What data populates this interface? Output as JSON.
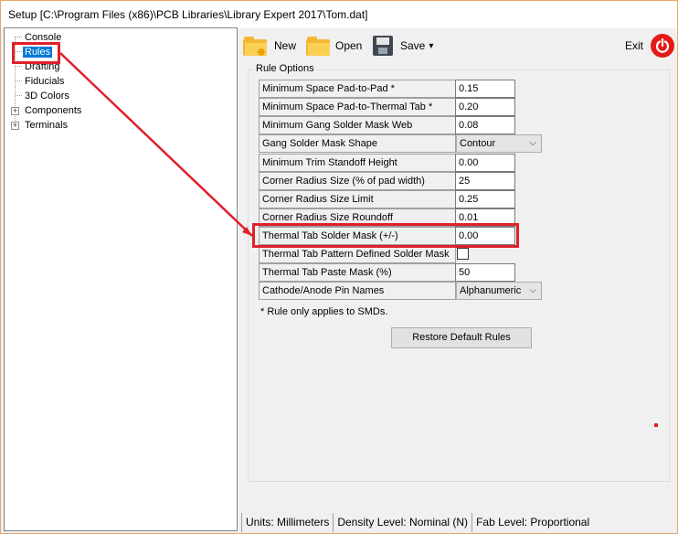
{
  "window": {
    "title": "Setup [C:\\Program Files (x86)\\PCB Libraries\\Library Expert 2017\\Tom.dat]"
  },
  "tree": {
    "items": [
      {
        "label": "Console"
      },
      {
        "label": "Rules",
        "selected": true
      },
      {
        "label": "Drafting"
      },
      {
        "label": "Fiducials"
      },
      {
        "label": "3D Colors"
      },
      {
        "label": "Components",
        "expandable": true
      },
      {
        "label": "Terminals",
        "expandable": true
      }
    ],
    "expand_glyph": "+"
  },
  "toolbar": {
    "new_label": "New",
    "open_label": "Open",
    "save_label": "Save",
    "save_dropdown_glyph": "▾",
    "exit_label": "Exit",
    "icons": [
      "new-folder-icon",
      "open-folder-icon",
      "save-disk-icon",
      "power-icon"
    ]
  },
  "rules": {
    "group_title": "Rule Options",
    "rows": [
      {
        "label": "Minimum Space Pad-to-Pad *",
        "value": "0.15",
        "type": "text"
      },
      {
        "label": "Minimum Space Pad-to-Thermal Tab *",
        "value": "0.20",
        "type": "text"
      },
      {
        "label": "Minimum Gang Solder Mask Web",
        "value": "0.08",
        "type": "text"
      },
      {
        "label": "Gang Solder Mask Shape",
        "value": "Contour",
        "type": "select"
      },
      {
        "label": "Minimum Trim Standoff Height",
        "value": "0.00",
        "type": "text"
      },
      {
        "label": "Corner Radius Size (% of pad width)",
        "value": "25",
        "type": "text"
      },
      {
        "label": "Corner Radius Size Limit",
        "value": "0.25",
        "type": "text"
      },
      {
        "label": "Corner Radius Size Roundoff",
        "value": "0.01",
        "type": "text"
      },
      {
        "label": "Thermal Tab Solder Mask (+/-)",
        "value": "0.00",
        "type": "text"
      },
      {
        "label": "Thermal Tab Pattern Defined Solder Mask",
        "value": "",
        "type": "checkbox",
        "checked": false
      },
      {
        "label": "Thermal Tab Paste Mask (%)",
        "value": "50",
        "type": "text"
      },
      {
        "label": "Cathode/Anode Pin Names",
        "value": "Alphanumeric",
        "type": "select"
      }
    ],
    "note": "* Rule only applies to SMDs.",
    "restore_label": "Restore Default Rules",
    "select_glyph": "⌵"
  },
  "status": {
    "units": "Units:   Millimeters",
    "density": "Density Level: Nominal (N)",
    "fab": "Fab Level: Proportional"
  },
  "colors": {
    "annotation_red": "#e0202a",
    "selection_blue": "#0078d7",
    "power_red": "#e41b17"
  }
}
